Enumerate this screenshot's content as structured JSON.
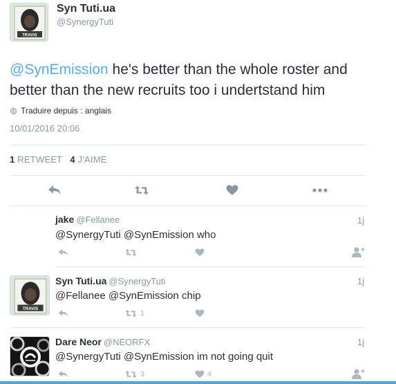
{
  "tweet": {
    "author_name": "Syn Tuti.ua",
    "author_handle": "@SynergyTuti",
    "avatar_caption": "TRAVIS",
    "text_mention": "@SynEmission",
    "text_body": " he's better than the whole roster and better than the new recruits too i undertstand him",
    "translate_label": "Traduire depuis : anglais",
    "timestamp": "10/01/2016 20:06",
    "retweet_count": "1",
    "retweet_label": "RETWEET",
    "like_count": "4",
    "like_label": "J'AIME"
  },
  "actions": {
    "reply_icon": "reply-icon",
    "retweet_icon": "retweet-icon",
    "like_icon": "heart-icon",
    "more_icon": "more-icon"
  },
  "replies": [
    {
      "name": "jake",
      "handle": "@Fellanee",
      "time": "1j",
      "text": "@SynergyTuti @SynEmission who",
      "retweets": "",
      "likes": "",
      "has_avatar": false
    },
    {
      "name": "Syn Tuti.ua",
      "handle": "@SynergyTuti",
      "time": "1j",
      "text": "@Fellanee @SynEmission chip",
      "retweets": "1",
      "likes": "",
      "has_avatar": true,
      "avatar_caption": "TRAVIS"
    },
    {
      "name": "Dare Neor",
      "handle": "@NEORFX",
      "time": "1j",
      "text": "@SynergyTuti @SynEmission im not going quit",
      "retweets": "3",
      "likes": "4",
      "has_avatar": true
    }
  ],
  "colors": {
    "accent": "#55acee",
    "text": "#292f33",
    "muted": "#8899a6",
    "icon": "#8899a6",
    "divider": "#e1e8ed"
  }
}
